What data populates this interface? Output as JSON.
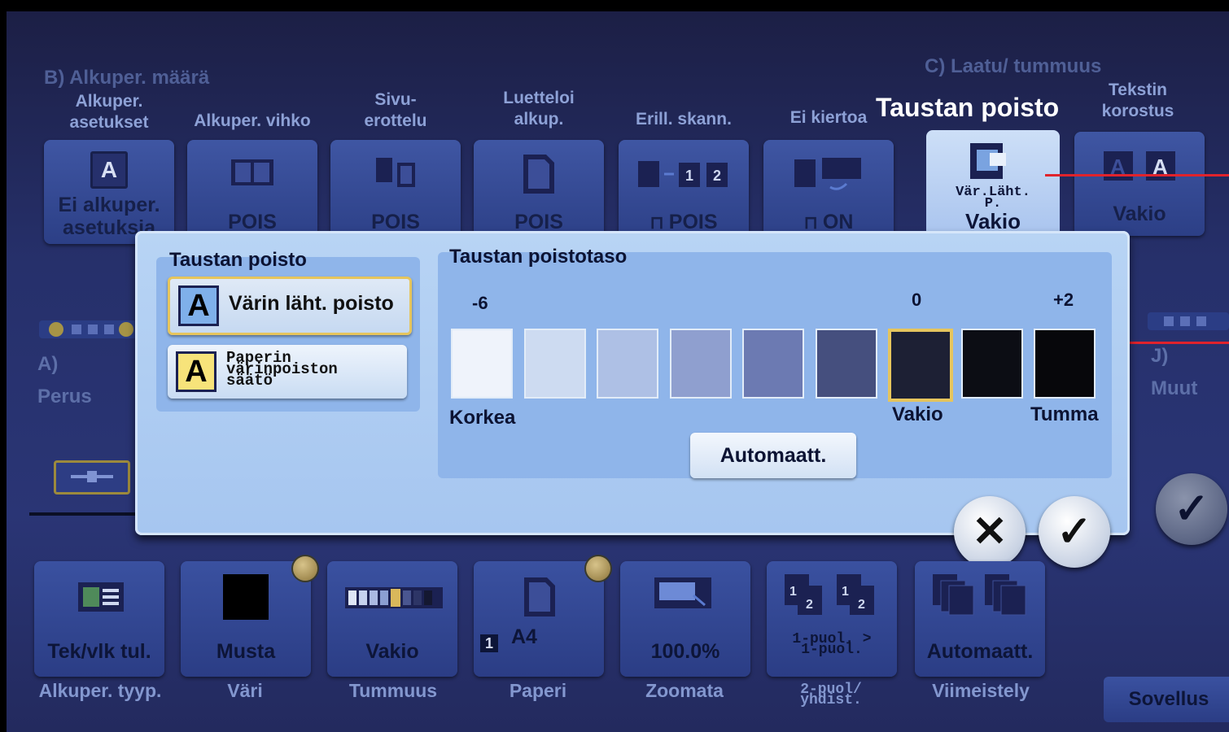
{
  "sections": {
    "b_label": "B)  Alkuper. määrä",
    "c_label": "C)  Laatu/ tummuus",
    "a_label": "A)",
    "a_sub": "Perus",
    "j_label": "J)",
    "j_sub": "Muut"
  },
  "top_tiles": [
    {
      "label": "Alkuper.\nasetukset",
      "value": "Ei alkuper.\nasetuksia",
      "icon": "A"
    },
    {
      "label": "Alkuper. vihko",
      "value": "POIS",
      "icon": "book-icon"
    },
    {
      "label": "Sivu-\nerottelu",
      "value": "POIS",
      "icon": "pages-icon"
    },
    {
      "label": "Luetteloi\nalkup.",
      "value": "POIS",
      "icon": "page-icon"
    },
    {
      "label": "Erill. skann.",
      "value": "POIS",
      "icon": "separate-scan-icon"
    },
    {
      "label": "Ei kiertoa",
      "value": "ON",
      "icon": "rotate-icon"
    },
    {
      "label": "Tekstin\nkorostus",
      "value": "Vakio",
      "icon": "A"
    }
  ],
  "active_tile": {
    "title": "Taustan poisto",
    "sub": "Vär.Läht.\nP.",
    "value": "Vakio"
  },
  "dialog": {
    "left_title": "Taustan poisto",
    "opt1": "Värin läht. poisto",
    "opt2": "Paperin\nvärinpoiston\nsäätö",
    "right_title": "Taustan poistotaso",
    "scale_min": "-6",
    "scale_mid": "0",
    "scale_max": "+2",
    "lbl_high": "Korkea",
    "lbl_std": "Vakio",
    "lbl_dark": "Tumma",
    "auto": "Automaatt.",
    "swatches": [
      "#eff3fb",
      "#cddbf1",
      "#aec0e5",
      "#8f9fcf",
      "#6c7ab2",
      "#454f7e",
      "#1d2034",
      "#0c0d14",
      "#07070b"
    ],
    "selected_index": 6
  },
  "bottom_tiles": [
    {
      "value": "Tek/vlk tul.",
      "label": "Alkuper. tyyp."
    },
    {
      "value": "Musta",
      "label": "Väri"
    },
    {
      "value": "Vakio",
      "label": "Tummuus"
    },
    {
      "value": "A4",
      "badge": "1",
      "label": "Paperi"
    },
    {
      "value": "100.0%",
      "label": "Zoomata"
    },
    {
      "value": "1-puol. >\n1-puol.",
      "label": "2-puol/\nyhdist."
    },
    {
      "value": "Automaatt.",
      "label": "Viimeistely"
    }
  ],
  "sovellus": "Sovellus",
  "cancel": "✕",
  "ok": "✓"
}
